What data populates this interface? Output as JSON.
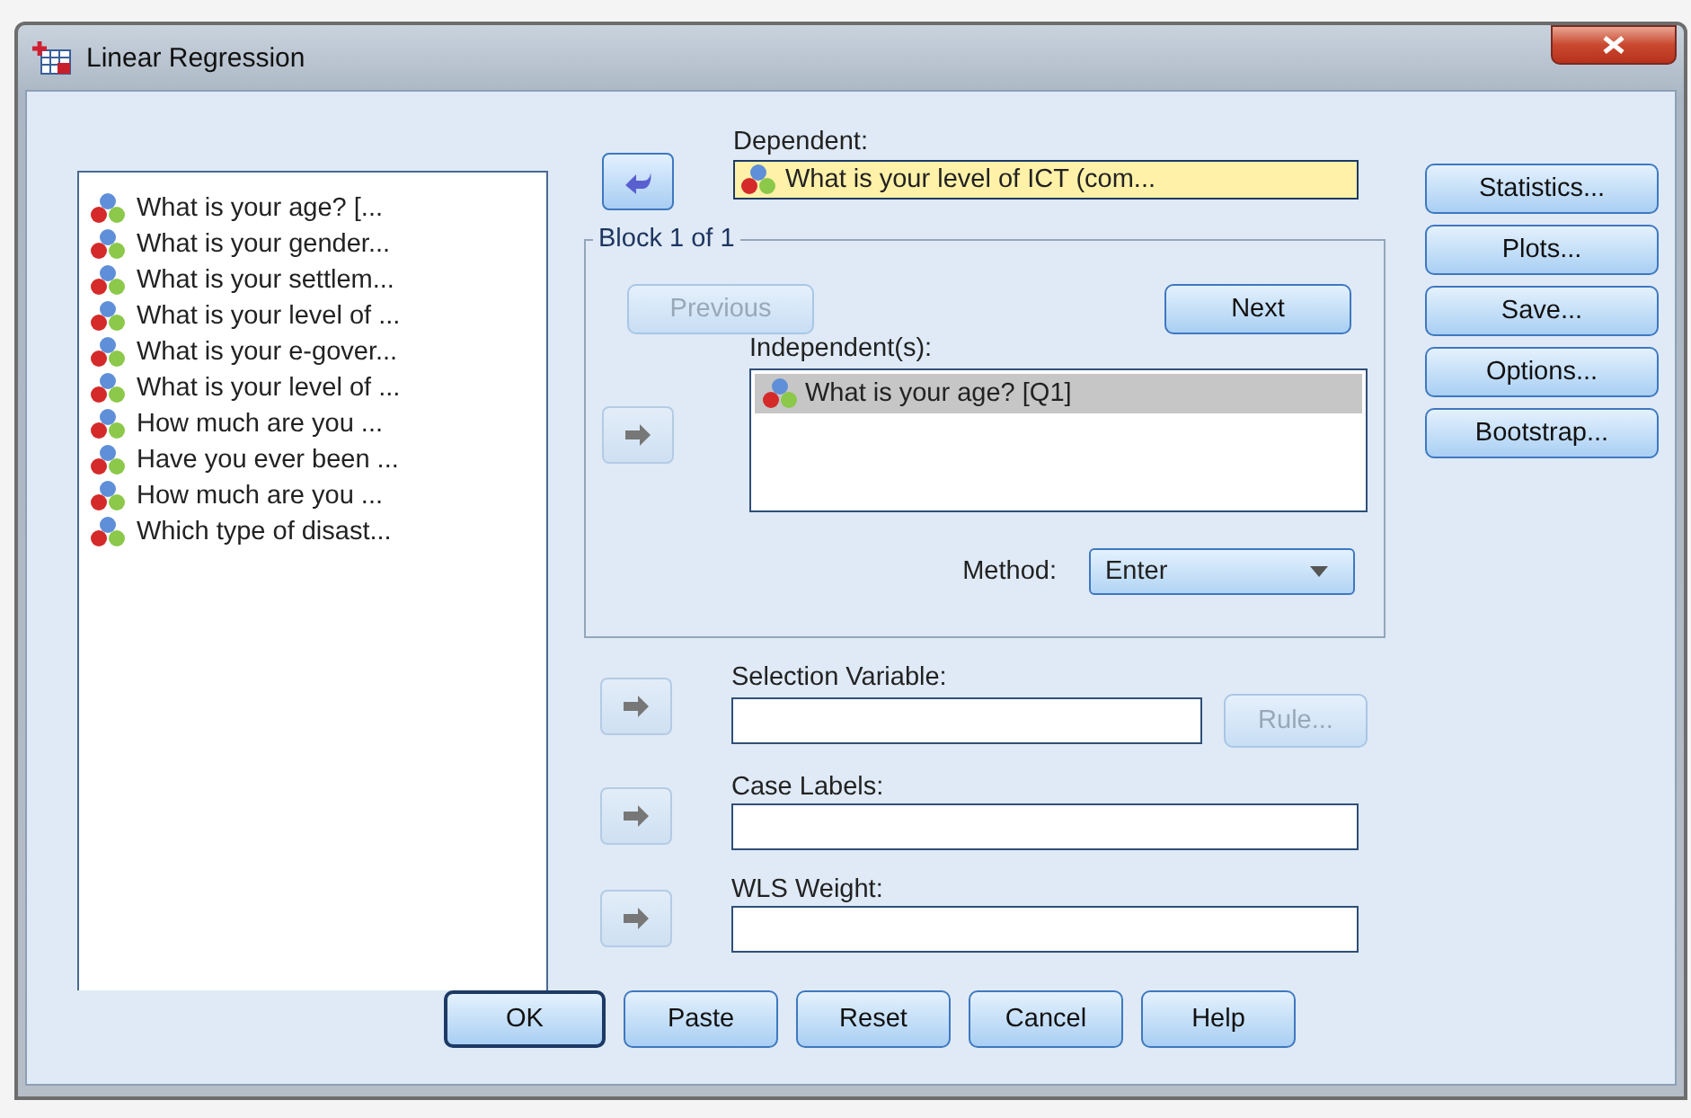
{
  "window": {
    "title": "Linear Regression"
  },
  "variables": [
    {
      "label": "What is your age? [..."
    },
    {
      "label": "What is your gender..."
    },
    {
      "label": "What is your settlem..."
    },
    {
      "label": "What is your level of ..."
    },
    {
      "label": "What is your e-gover..."
    },
    {
      "label": "What is your level of ..."
    },
    {
      "label": "How much are you ..."
    },
    {
      "label": "Have you ever been ..."
    },
    {
      "label": "How much are you ..."
    },
    {
      "label": "Which type of disast..."
    }
  ],
  "dependent": {
    "label": "Dependent:",
    "value": "What is your level of ICT (com...",
    "arrow": {
      "kind": "back",
      "disabled": false
    }
  },
  "block": {
    "title": "Block 1 of 1",
    "previous": {
      "label": "Previous",
      "disabled": true
    },
    "next": {
      "label": "Next",
      "disabled": false
    },
    "independents": {
      "label": "Independent(s):",
      "arrow": {
        "kind": "forward",
        "disabled": true
      },
      "items": [
        {
          "label": "What is your age? [Q1]",
          "selected": true
        }
      ]
    },
    "method": {
      "label": "Method:",
      "value": "Enter"
    }
  },
  "selection_variable": {
    "label": "Selection Variable:",
    "arrow": {
      "kind": "forward",
      "disabled": true
    },
    "rule": {
      "label": "Rule...",
      "disabled": true
    }
  },
  "case_labels": {
    "label": "Case Labels:",
    "arrow": {
      "kind": "forward",
      "disabled": true
    }
  },
  "wls_weight": {
    "label": "WLS Weight:",
    "arrow": {
      "kind": "forward",
      "disabled": true
    }
  },
  "side_buttons": [
    {
      "label": "Statistics..."
    },
    {
      "label": "Plots..."
    },
    {
      "label": "Save..."
    },
    {
      "label": "Options..."
    },
    {
      "label": "Bootstrap..."
    }
  ],
  "buttons": [
    {
      "label": "OK",
      "default": true
    },
    {
      "label": "Paste",
      "default": false
    },
    {
      "label": "Reset",
      "default": false
    },
    {
      "label": "Cancel",
      "default": false
    },
    {
      "label": "Help",
      "default": false
    }
  ]
}
